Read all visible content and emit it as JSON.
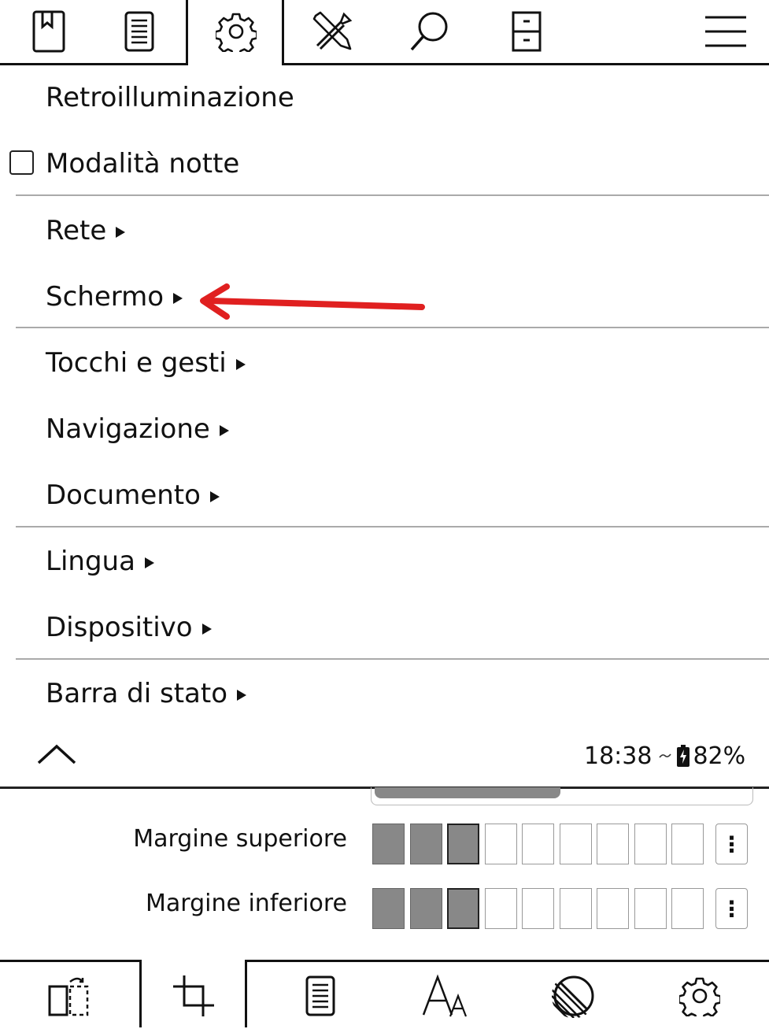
{
  "top_tabs": [
    {
      "icon": "bookmark-icon"
    },
    {
      "icon": "document-icon"
    },
    {
      "icon": "gear-icon",
      "active": true
    },
    {
      "icon": "tools-icon"
    },
    {
      "icon": "search-icon"
    },
    {
      "icon": "file-cabinet-icon"
    },
    {
      "icon": "hamburger-menu-icon"
    }
  ],
  "menu": {
    "items": [
      {
        "label": "Retroilluminazione",
        "submenu": false
      },
      {
        "label": "Modalità notte",
        "checkbox": true,
        "checked": false
      },
      {
        "label": "Rete",
        "submenu": true
      },
      {
        "label": "Schermo",
        "submenu": true
      },
      {
        "label": "Tocchi e gesti",
        "submenu": true
      },
      {
        "label": "Navigazione",
        "submenu": true
      },
      {
        "label": "Documento",
        "submenu": true
      },
      {
        "label": "Lingua",
        "submenu": true
      },
      {
        "label": "Dispositivo",
        "submenu": true
      },
      {
        "label": "Barra di stato",
        "submenu": true
      }
    ]
  },
  "status": {
    "time": "18:38",
    "battery": "82%"
  },
  "annotation": {
    "arrow_color": "#e02020"
  },
  "margins": {
    "top": {
      "label": "Margine superiore",
      "level": 3,
      "steps": 10,
      "more": "⋮"
    },
    "bottom": {
      "label": "Margine inferiore",
      "level": 3,
      "steps": 10,
      "more": "⋮"
    }
  },
  "bottom_tabs": [
    {
      "icon": "page-rotate-icon"
    },
    {
      "icon": "crop-icon",
      "active": true
    },
    {
      "icon": "document-icon"
    },
    {
      "icon": "font-size-icon"
    },
    {
      "icon": "contrast-icon"
    },
    {
      "icon": "gear-icon"
    }
  ]
}
